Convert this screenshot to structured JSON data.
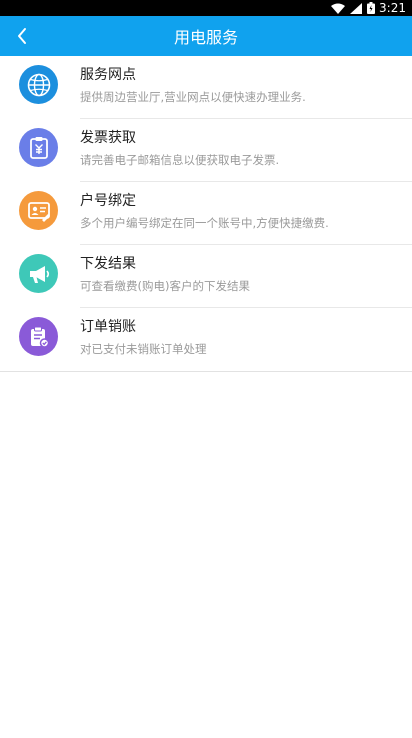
{
  "status_bar": {
    "time": "3:21",
    "icons": [
      "wifi-icon",
      "signal-icon",
      "battery-icon"
    ]
  },
  "app_bar": {
    "title": "用电服务",
    "back_icon": "chevron-left-icon"
  },
  "colors": {
    "primary": "#10a2ee",
    "icon_blue": "#1c8fde",
    "icon_indigo": "#6a7ee8",
    "icon_orange": "#f59a3c",
    "icon_teal": "#3ec8b8",
    "icon_purple": "#8a5ad8"
  },
  "services": [
    {
      "title": "服务网点",
      "subtitle": "提供周边营业厅,营业网点以便快速办理业务.",
      "icon": "globe-icon"
    },
    {
      "title": "发票获取",
      "subtitle": "请完善电子邮箱信息以便获取电子发票.",
      "icon": "invoice-icon"
    },
    {
      "title": "户号绑定",
      "subtitle": "多个用户编号绑定在同一个账号中,方便快捷缴费.",
      "icon": "id-card-icon"
    },
    {
      "title": "下发结果",
      "subtitle": "可查看缴费(购电)客户的下发结果",
      "icon": "megaphone-icon"
    },
    {
      "title": "订单销账",
      "subtitle": "对已支付未销账订单处理",
      "icon": "clipboard-icon"
    }
  ]
}
